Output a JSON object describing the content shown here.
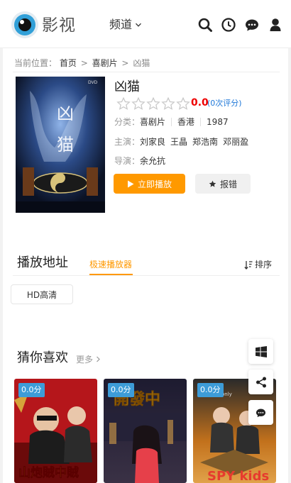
{
  "header": {
    "brand": "影视",
    "channel_label": "频道",
    "icons": [
      "search-icon",
      "history-icon",
      "message-icon",
      "user-icon"
    ]
  },
  "breadcrumb": {
    "prefix": "当前位置：",
    "home": "首页",
    "category": "喜剧片",
    "current": "凶猫",
    "separator": ">"
  },
  "movie": {
    "title": "凶猫",
    "score": "0.0",
    "score_count": "(0次评分)",
    "stars_filled": 0,
    "genre_label": "分类：",
    "genre": "喜剧片",
    "region": "香港",
    "year": "1987",
    "cast_label": "主演：",
    "cast": [
      "刘家良",
      "王晶",
      "郑浩南",
      "邓丽盈"
    ],
    "director_label": "导演：",
    "director": "余允抗",
    "play_label": "立即播放",
    "report_label": "报错"
  },
  "sources": {
    "title": "播放地址",
    "active_tab": "极速播放器",
    "sort_label": "排序",
    "episodes": [
      "HD高清"
    ]
  },
  "recommend": {
    "title": "猜你喜欢",
    "more_label": "更多",
    "items": [
      {
        "score": "0.0分",
        "poster_text": "山炮賊中賊"
      },
      {
        "score": "0.0分",
        "poster_text": "開發中"
      },
      {
        "score": "0.0分",
        "poster_text": "SPY kids"
      }
    ]
  },
  "float": {
    "icons": [
      "windows-icon",
      "share-icon",
      "chat-icon"
    ]
  },
  "colors": {
    "accent": "#ff9900",
    "score": "#ee0000",
    "link": "#1f78d8",
    "badge": "#3d9cd8"
  }
}
